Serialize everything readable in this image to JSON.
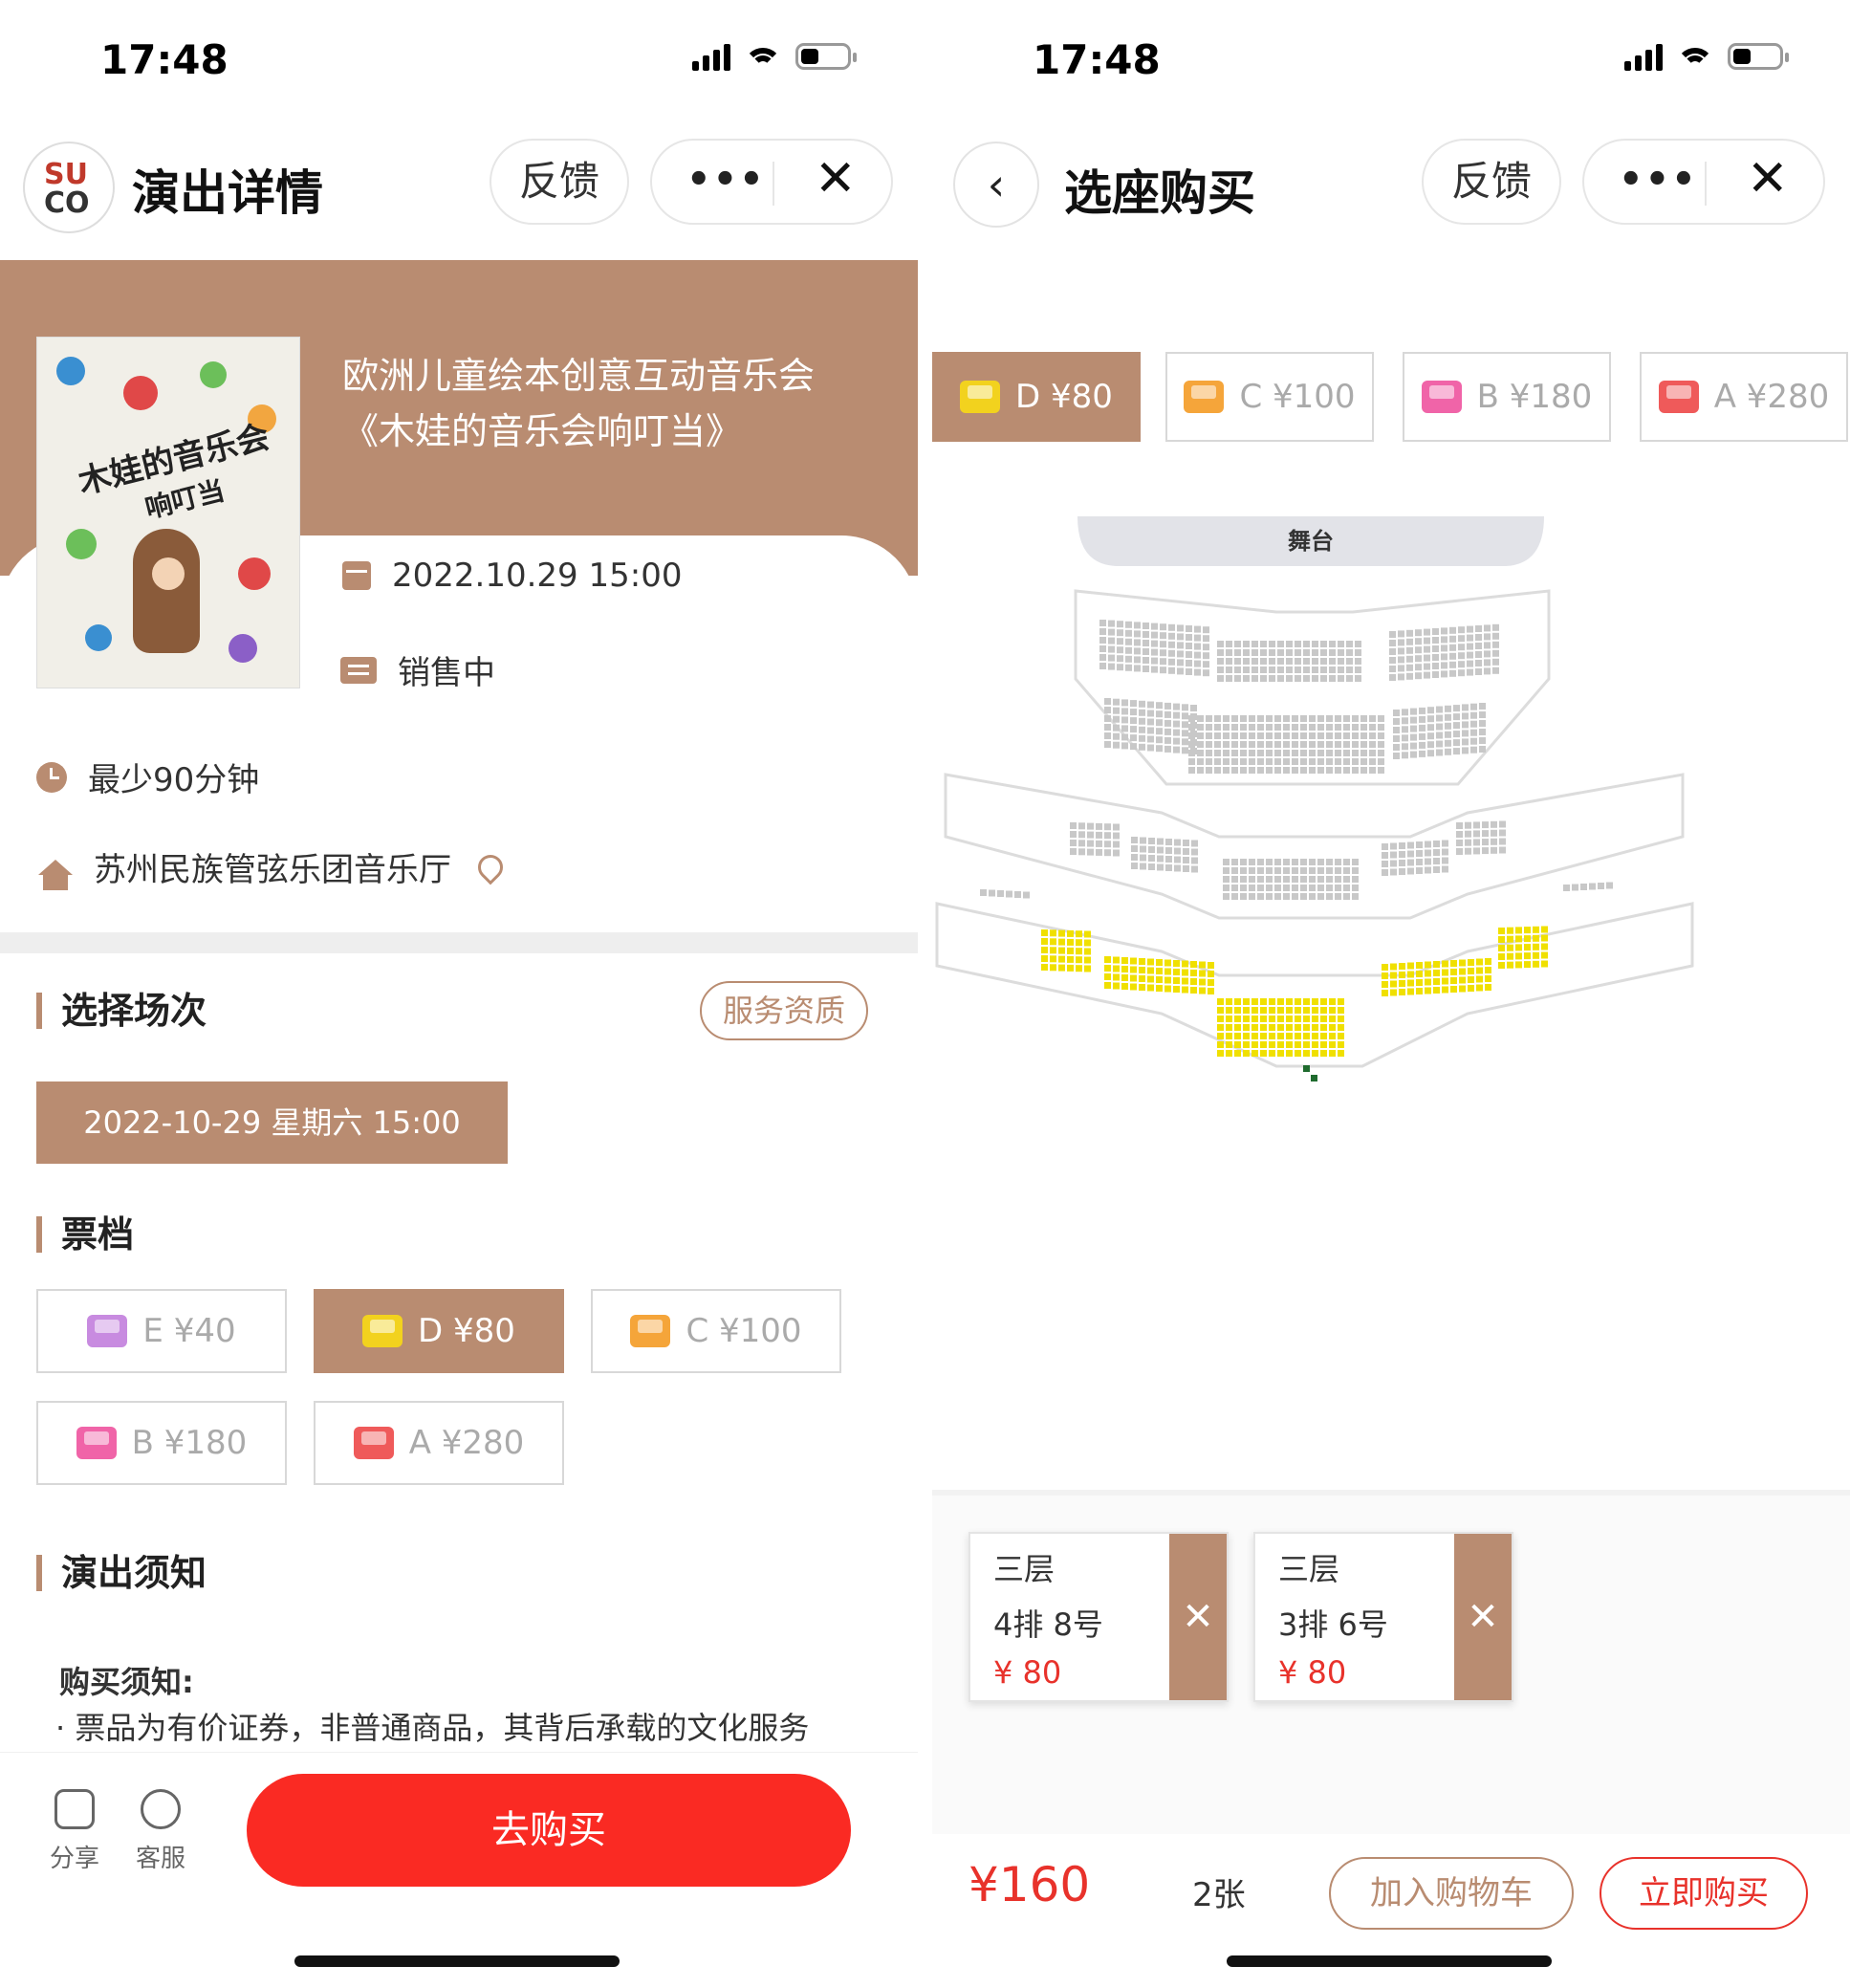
{
  "left": {
    "status": {
      "time": "17:48"
    },
    "nav": {
      "logo_top": "SU",
      "logo_bottom": "CO",
      "title": "演出详情",
      "feedback": "反馈",
      "more": "•••",
      "close": "✕"
    },
    "show": {
      "title": "欧洲儿童绘本创意互动音乐会《木娃的音乐会响叮当》",
      "poster_title": "木娃的音乐会",
      "poster_subtitle": "响叮当",
      "datetime": "2022.10.29 15:00",
      "sale_status": "销售中",
      "duration": "最少90分钟",
      "venue": "苏州民族管弦乐团音乐厅"
    },
    "session": {
      "heading": "选择场次",
      "service_label": "服务资质",
      "selected": "2022-10-29 星期六 15:00"
    },
    "tiers": {
      "heading": "票档",
      "items": [
        {
          "label": "E ¥40",
          "color": "#c88be0",
          "selected": false
        },
        {
          "label": "D ¥80",
          "color": "#f2d21e",
          "selected": true
        },
        {
          "label": "C ¥100",
          "color": "#f5a53a",
          "selected": false
        },
        {
          "label": "B ¥180",
          "color": "#f064a8",
          "selected": false
        },
        {
          "label": "A ¥280",
          "color": "#ef5a5a",
          "selected": false
        }
      ]
    },
    "notice": {
      "heading": "演出须知",
      "bold": "购买须知:",
      "text": "· 票品为有价证券，非普通商品，其背后承载的文化服务"
    },
    "bottom": {
      "share": "分享",
      "service": "客服",
      "buy": "去购买"
    }
  },
  "right": {
    "status": {
      "time": "17:48"
    },
    "nav": {
      "back": "‹",
      "title": "选座购买",
      "feedback": "反馈",
      "more": "•••",
      "close": "✕"
    },
    "price_chips": [
      {
        "label": "D ¥80",
        "color": "#f2d21e",
        "selected": true
      },
      {
        "label": "C ¥100",
        "color": "#f5a53a",
        "selected": false
      },
      {
        "label": "B ¥180",
        "color": "#f064a8",
        "selected": false
      },
      {
        "label": "A ¥280",
        "color": "#ef5a5a",
        "selected": false
      }
    ],
    "seatmap": {
      "stage_label": "舞台",
      "available_color": "#f0e000",
      "unavailable_color": "#c8c8c8",
      "selected_color": "#1f6b2e"
    },
    "selected_seats": [
      {
        "floor": "三层",
        "seat": "4排 8号",
        "price": "¥ 80",
        "remove": "✕"
      },
      {
        "floor": "三层",
        "seat": "3排 6号",
        "price": "¥ 80",
        "remove": "✕"
      }
    ],
    "checkout": {
      "total": "¥160",
      "count": "2张",
      "add_to_cart": "加入购物车",
      "buy_now": "立即购买"
    }
  }
}
